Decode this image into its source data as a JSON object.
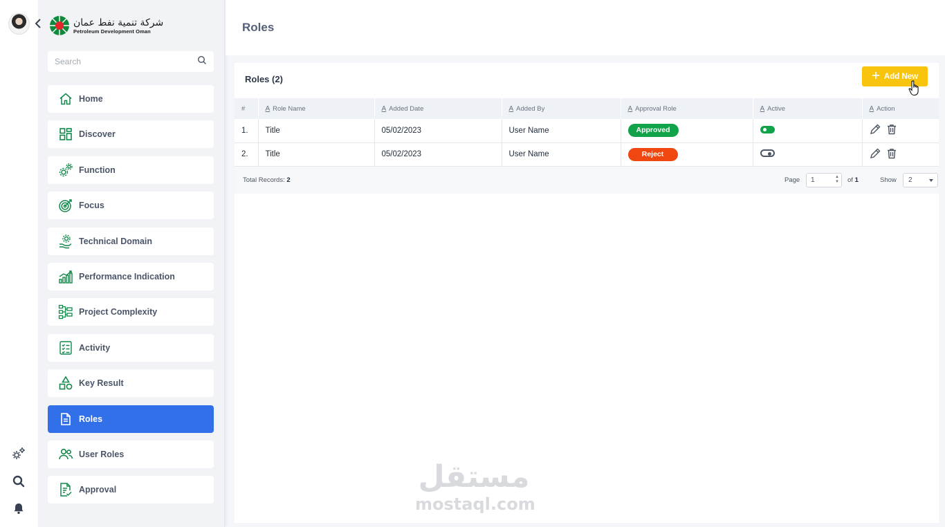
{
  "brand": {
    "name_ar": "شركة تنمية نفط عمان",
    "name_en": "Petroleum Development Oman"
  },
  "search": {
    "placeholder": "Search"
  },
  "sidebar": {
    "items": [
      {
        "label": "Home",
        "icon": "home-icon"
      },
      {
        "label": "Discover",
        "icon": "grid-icon"
      },
      {
        "label": "Function",
        "icon": "gears-icon"
      },
      {
        "label": "Focus",
        "icon": "target-icon"
      },
      {
        "label": "Technical Domain",
        "icon": "hand-gear-icon"
      },
      {
        "label": "Performance Indication",
        "icon": "bar-growth-icon"
      },
      {
        "label": "Project Complexity",
        "icon": "hierarchy-icon"
      },
      {
        "label": "Activity",
        "icon": "checklist-icon"
      },
      {
        "label": "Key Result",
        "icon": "shapes-icon"
      },
      {
        "label": "Roles",
        "icon": "document-icon",
        "active": true
      },
      {
        "label": "User Roles",
        "icon": "users-icon"
      },
      {
        "label": "Approval",
        "icon": "doc-check-icon"
      }
    ]
  },
  "page": {
    "title": "Roles"
  },
  "card": {
    "title": "Roles (2)",
    "add_label": "Add New"
  },
  "table": {
    "columns": [
      "#",
      "Role Name",
      "Added Date",
      "Added By",
      "Approval Role",
      "Active",
      "Action"
    ],
    "rows": [
      {
        "index": "1.",
        "name": "Title",
        "date": "05/02/2023",
        "by": "User Name",
        "approval": "Approved",
        "active": true
      },
      {
        "index": "2.",
        "name": "Title",
        "date": "05/02/2023",
        "by": "User Name",
        "approval": "Reject",
        "active": false
      }
    ]
  },
  "footer": {
    "total_label": "Total Records:",
    "total_value": "2",
    "page_label": "Page",
    "page_value": "1",
    "of_label": "of",
    "of_value": "1",
    "show_label": "Show",
    "show_value": "2"
  },
  "watermark": {
    "ar": "مستقل",
    "en": "mostaql.com"
  },
  "colors": {
    "accent": "#3170e8",
    "add_button": "#f8c40d",
    "approved": "#11a34a",
    "reject": "#f0460f",
    "icon_green": "#11884a"
  }
}
